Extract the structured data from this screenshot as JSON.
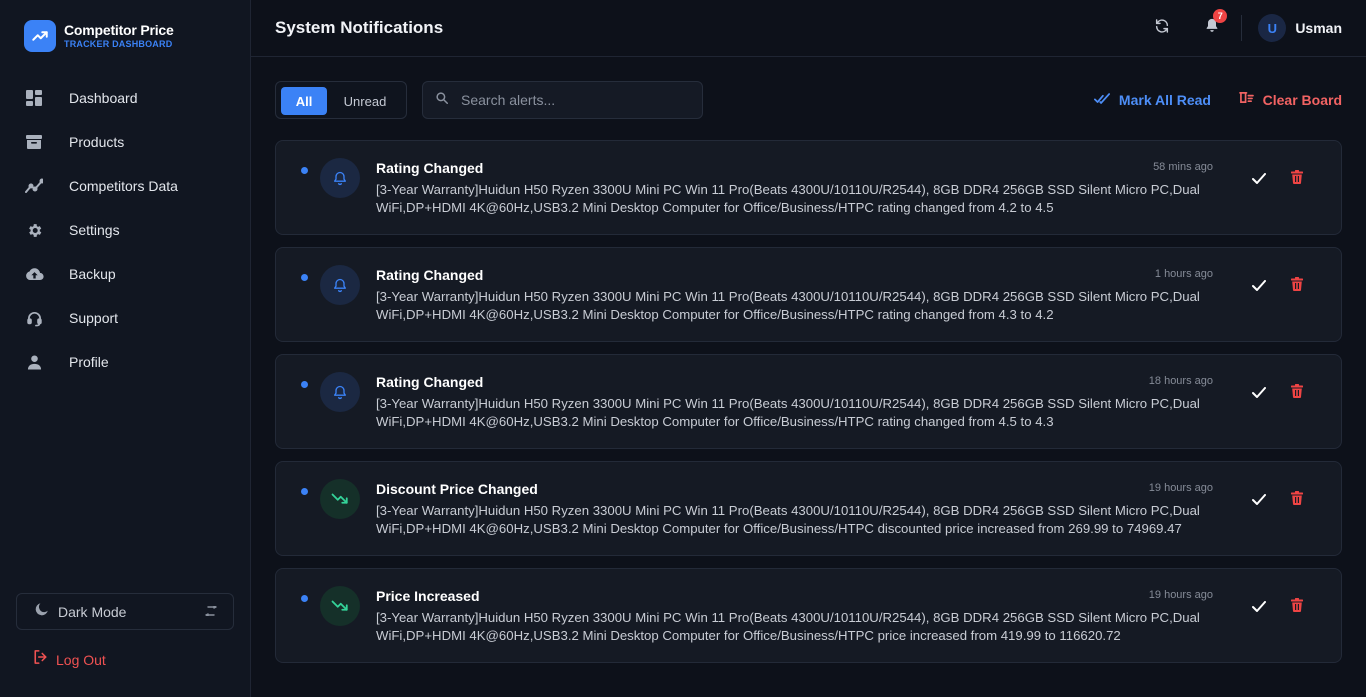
{
  "brand": {
    "title": "Competitor Price",
    "subtitle": "TRACKER DASHBOARD"
  },
  "sidebar": {
    "items": [
      {
        "label": "Dashboard",
        "icon": "dashboard-icon"
      },
      {
        "label": "Products",
        "icon": "archive-box-icon"
      },
      {
        "label": "Competitors Data",
        "icon": "chart-line-icon"
      },
      {
        "label": "Settings",
        "icon": "gear-icon"
      },
      {
        "label": "Backup",
        "icon": "cloud-upload-icon"
      },
      {
        "label": "Support",
        "icon": "headset-icon"
      },
      {
        "label": "Profile",
        "icon": "user-icon"
      }
    ],
    "dark_mode_label": "Dark Mode",
    "logout_label": "Log Out"
  },
  "header": {
    "title": "System Notifications",
    "notification_count": "7",
    "user_initial": "U",
    "user_name": "Usman"
  },
  "toolbar": {
    "filter_all": "All",
    "filter_unread": "Unread",
    "search_placeholder": "Search alerts...",
    "mark_all_read": "Mark All Read",
    "clear_board": "Clear Board"
  },
  "notifications": [
    {
      "type": "bell",
      "title": "Rating Changed",
      "time": "58 mins ago",
      "message": "[3-Year Warranty]Huidun H50 Ryzen 3300U Mini PC Win 11 Pro(Beats 4300U/10110U/R2544), 8GB DDR4 256GB SSD Silent Micro PC,Dual WiFi,DP+HDMI 4K@60Hz,USB3.2 Mini Desktop Computer for Office/Business/HTPC rating changed from 4.2 to 4.5"
    },
    {
      "type": "bell",
      "title": "Rating Changed",
      "time": "1 hours ago",
      "message": "[3-Year Warranty]Huidun H50 Ryzen 3300U Mini PC Win 11 Pro(Beats 4300U/10110U/R2544), 8GB DDR4 256GB SSD Silent Micro PC,Dual WiFi,DP+HDMI 4K@60Hz,USB3.2 Mini Desktop Computer for Office/Business/HTPC rating changed from 4.3 to 4.2"
    },
    {
      "type": "bell",
      "title": "Rating Changed",
      "time": "18 hours ago",
      "message": "[3-Year Warranty]Huidun H50 Ryzen 3300U Mini PC Win 11 Pro(Beats 4300U/10110U/R2544), 8GB DDR4 256GB SSD Silent Micro PC,Dual WiFi,DP+HDMI 4K@60Hz,USB3.2 Mini Desktop Computer for Office/Business/HTPC rating changed from 4.5 to 4.3"
    },
    {
      "type": "trend",
      "title": "Discount Price Changed",
      "time": "19 hours ago",
      "message": "[3-Year Warranty]Huidun H50 Ryzen 3300U Mini PC Win 11 Pro(Beats 4300U/10110U/R2544), 8GB DDR4 256GB SSD Silent Micro PC,Dual WiFi,DP+HDMI 4K@60Hz,USB3.2 Mini Desktop Computer for Office/Business/HTPC discounted price increased from 269.99 to 74969.47"
    },
    {
      "type": "trend",
      "title": "Price Increased",
      "time": "19 hours ago",
      "message": "[3-Year Warranty]Huidun H50 Ryzen 3300U Mini PC Win 11 Pro(Beats 4300U/10110U/R2544), 8GB DDR4 256GB SSD Silent Micro PC,Dual WiFi,DP+HDMI 4K@60Hz,USB3.2 Mini Desktop Computer for Office/Business/HTPC price increased from 419.99 to 116620.72"
    }
  ],
  "colors": {
    "accent": "#3b82f6",
    "danger": "#ef4444",
    "success": "#34d399",
    "background": "#0d111a",
    "card": "#151a24"
  }
}
